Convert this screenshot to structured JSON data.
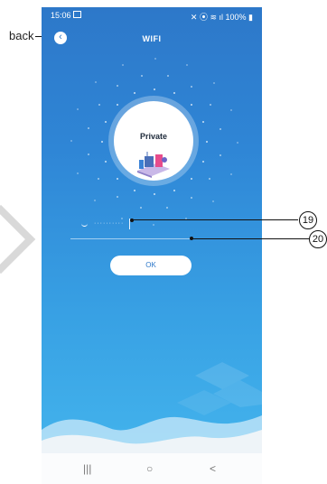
{
  "status_bar": {
    "time": "15:06",
    "battery": "100%"
  },
  "header": {
    "title": "WIFI"
  },
  "wifi": {
    "ssid": "Private",
    "password_mask": "··········"
  },
  "ok_button": {
    "label": "OK"
  },
  "annotations": {
    "back_label": "back",
    "callout_19": "19",
    "callout_20": "20"
  },
  "nav": {
    "recents": "|||",
    "home": "○",
    "back": "<"
  },
  "colors": {
    "bg_top": "#2d78c9",
    "bg_bottom": "#45b7ee",
    "accent": "#2d78c9"
  }
}
